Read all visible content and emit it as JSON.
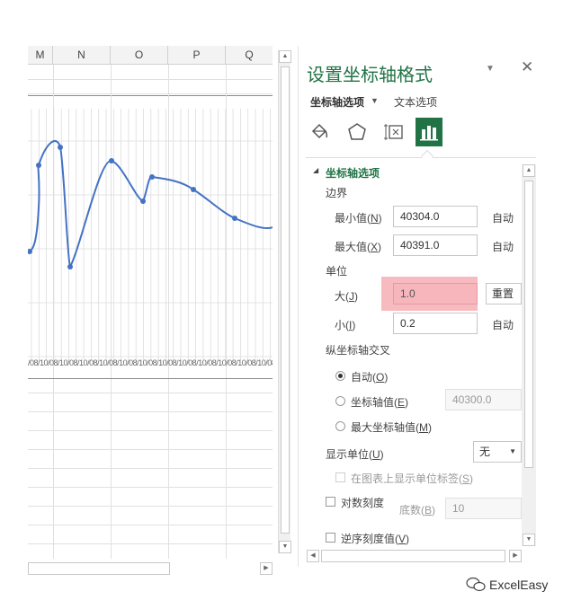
{
  "sheet": {
    "columns": [
      "M",
      "N",
      "O",
      "P",
      "Q"
    ],
    "tick_labels": "/08/10/08/10/08/10/08/10/08/10/08/10/08/10/08/10/08/10/08/10/08/10/08/10/08/10/08/10/08/10/08/10/08/10/08/10/08/10/08/10/08/10",
    "scroll_up_icon": "triangle-up",
    "scroll_down_icon": "triangle-down",
    "scroll_right_icon": "triangle-right",
    "line_color": "#4472C4"
  },
  "pane": {
    "title": "设置坐标轴格式",
    "dropdown_icon": "▼",
    "close_icon": "✕",
    "tab_axis_options": "坐标轴选项",
    "tab_axis_caret": "▼",
    "tab_text_options": "文本选项",
    "icons": [
      "fill-line-icon",
      "effects-pentagon-icon",
      "size-properties-icon",
      "axis-options-bars-icon"
    ],
    "accent_color": "#217346",
    "section_toggle": "◢",
    "section_title": "坐标轴选项",
    "bounds_label": "边界",
    "min_label": "最小值(",
    "min_key": "N",
    "min_value": "40304.0",
    "min_auto": "自动",
    "max_label": "最大值(",
    "max_key": "X",
    "max_value": "40391.0",
    "max_auto": "自动",
    "units_label": "单位",
    "major_label": "大(",
    "major_key": "J",
    "major_value": "1.0",
    "major_reset": "重置",
    "minor_label": "小(",
    "minor_key": "I",
    "minor_value": "0.2",
    "minor_auto": "自动",
    "cross_label": "纵坐标轴交叉",
    "cross_auto": "自动(",
    "cross_auto_key": "O",
    "cross_value_label": "坐标轴值(",
    "cross_value_key": "E",
    "cross_value": "40300.0",
    "cross_max_label": "最大坐标轴值(",
    "cross_max_key": "M",
    "display_units_label": "显示单位(",
    "display_units_key": "U",
    "display_units_value": "无",
    "show_units_label": "在图表上显示单位标签(",
    "show_units_key": "S",
    "log_scale_label": "对数刻度",
    "base_label": "底数(",
    "base_key": "B",
    "base_value": "10",
    "reverse_label": "逆序刻度值(",
    "reverse_key": "V",
    "close_paren": ")"
  },
  "watermark": {
    "text": "ExcelEasy"
  }
}
